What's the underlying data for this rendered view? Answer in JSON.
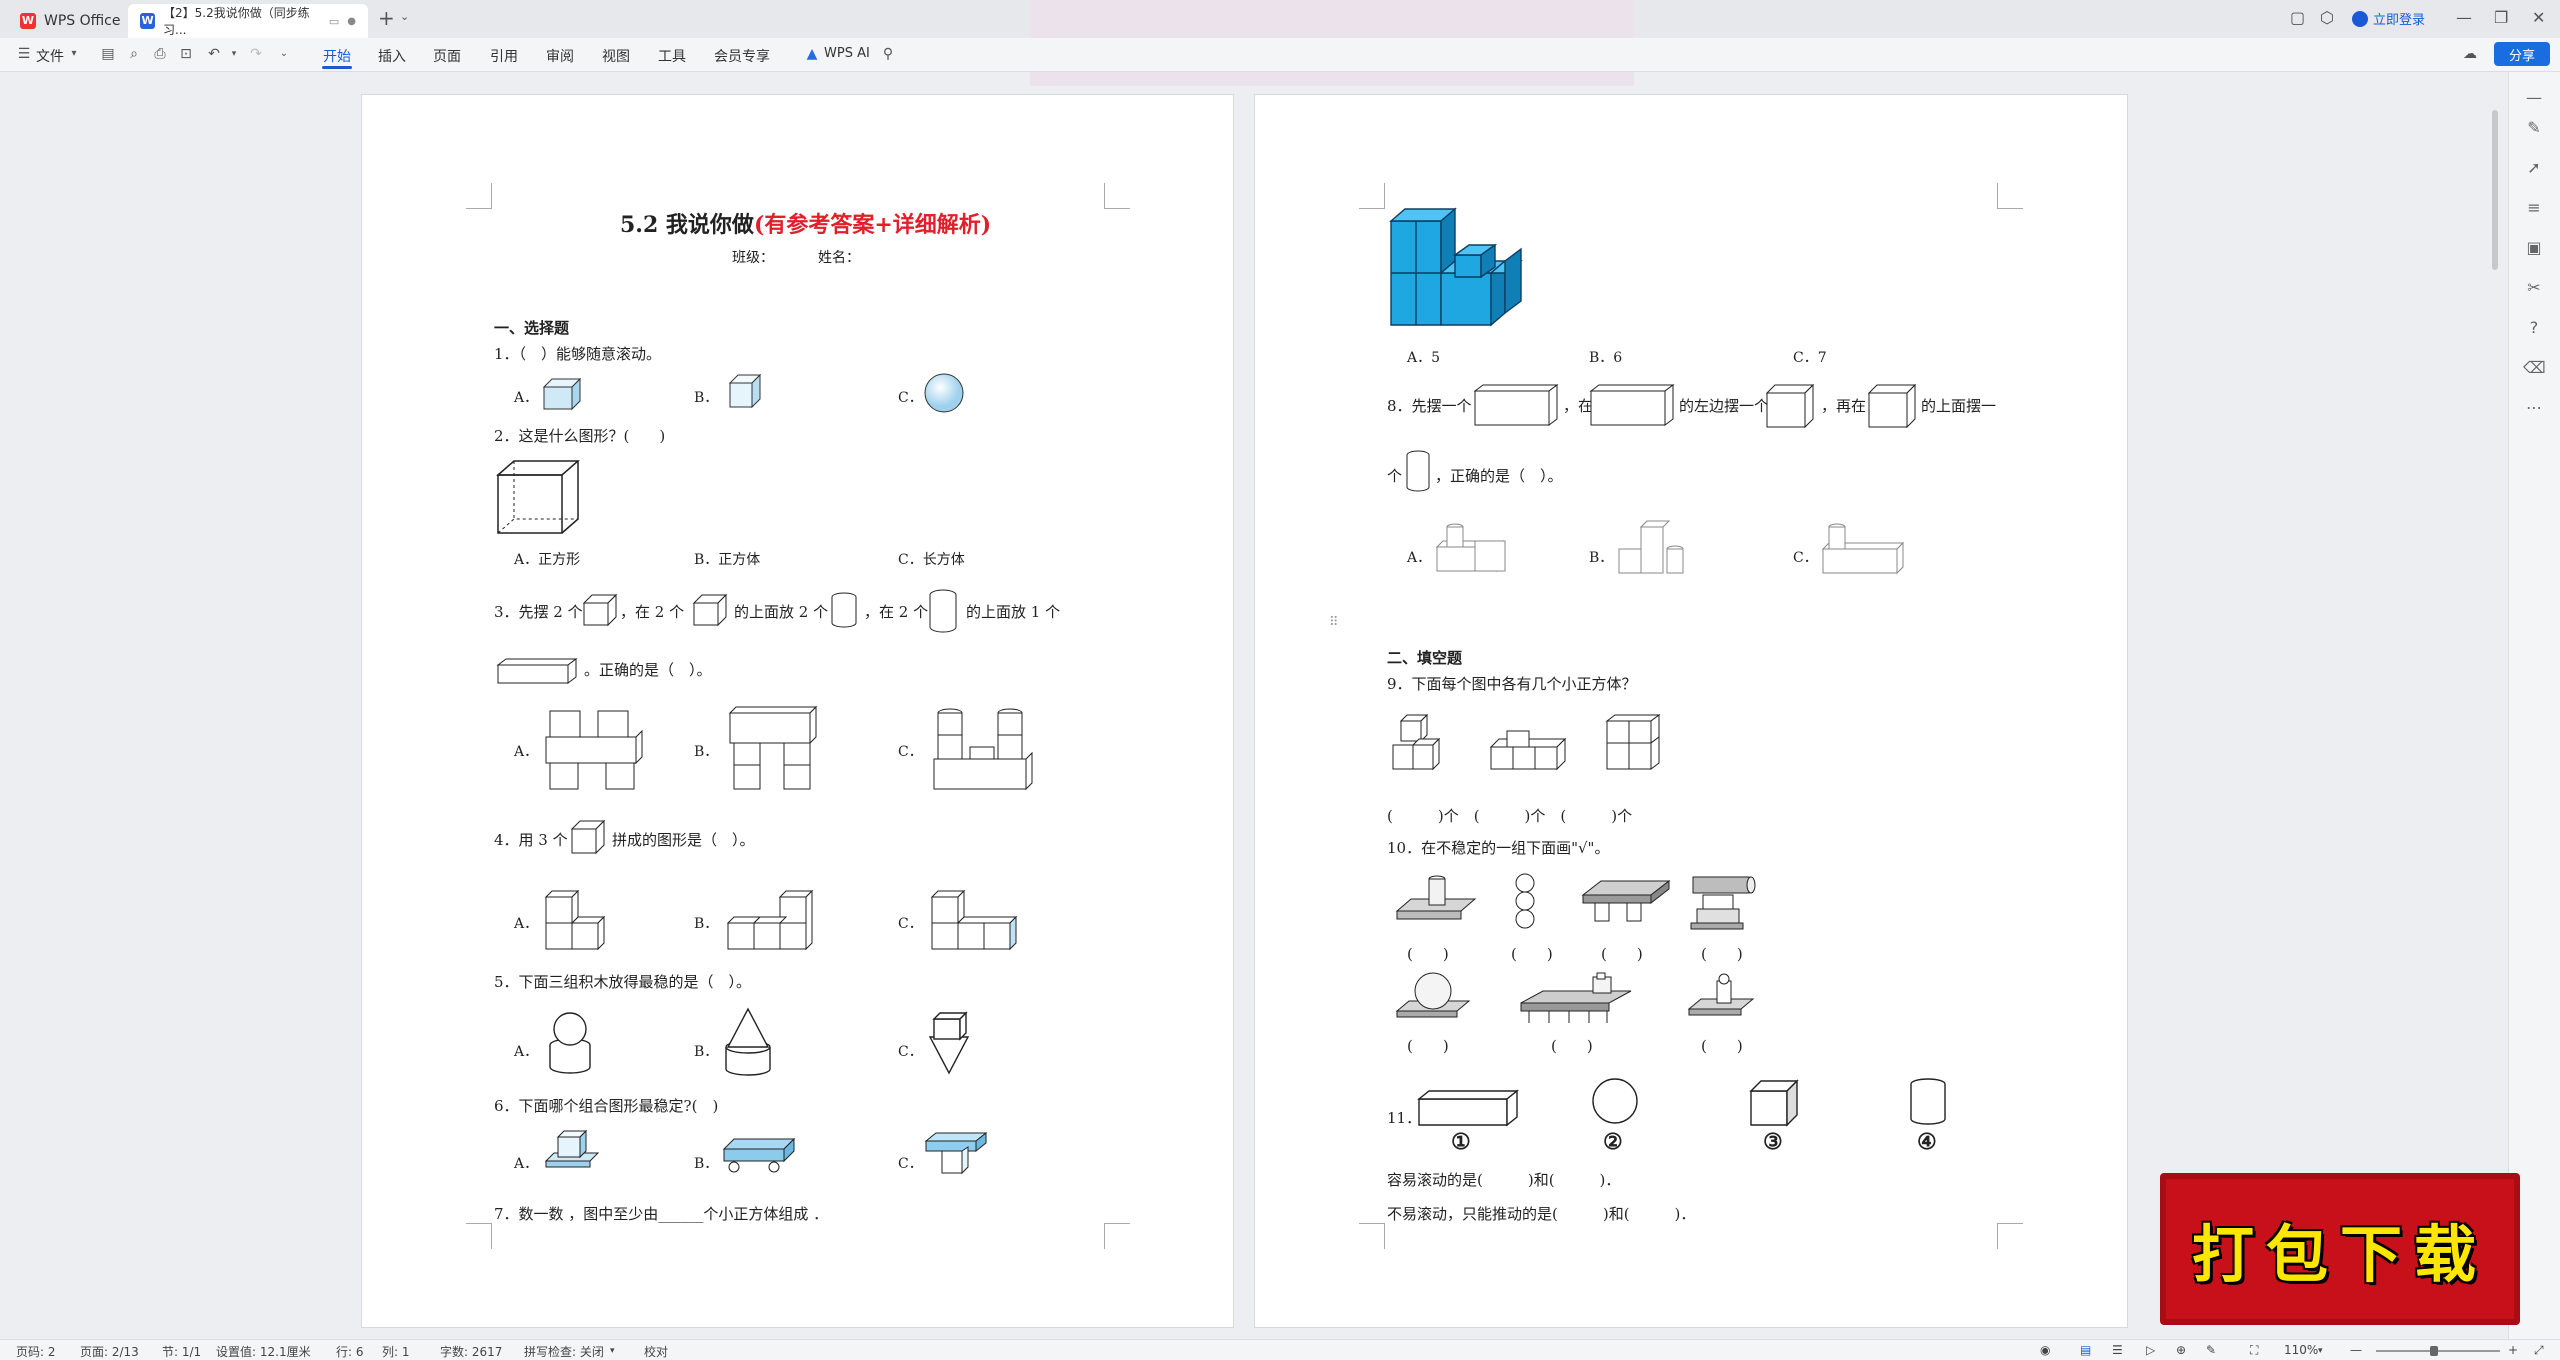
{
  "titlebar": {
    "app_tab": "WPS Office",
    "doc_tab": "【2】5.2我说你做（同步练习...",
    "new_tab": "+",
    "login": "立即登录"
  },
  "toolbar": {
    "file_menu": "文件",
    "tabs": [
      "开始",
      "插入",
      "页面",
      "引用",
      "审阅",
      "视图",
      "工具",
      "会员专享"
    ],
    "wps_ai": "WPS AI",
    "share": "分享"
  },
  "page1": {
    "title_main": "5.2 我说你做",
    "title_red": "(有参考答案+详细解析)",
    "class_label": "班级：",
    "name_label": "姓名：",
    "section1": "一、选择题",
    "q1": "1．（　）能够随意滚动。",
    "q1_opts": [
      "A．",
      "B．",
      "C．"
    ],
    "q2": "2．这是什么图形？(　　)",
    "q2_opts": [
      "A．正方形",
      "B．正方体",
      "C．长方体"
    ],
    "q3_line1_a": "3．先摆 2 个",
    "q3_line1_b": "，在 2 个",
    "q3_line1_c": "的上面放 2 个",
    "q3_line1_d": "，在 2 个",
    "q3_line1_e": "的上面放 1 个",
    "q3_line2": "。正确的是（　）。",
    "q3_opts": [
      "A．",
      "B．",
      "C．"
    ],
    "q4_a": "4．用 3 个",
    "q4_b": "拼成的图形是（　）。",
    "q4_opts": [
      "A．",
      "B．",
      "C．"
    ],
    "q5": "5．下面三组积木放得最稳的是（　）。",
    "q5_opts": [
      "A．",
      "B．",
      "C．"
    ],
    "q6": "6．下面哪个组合图形最稳定?(　)",
    "q6_opts": [
      "A．",
      "B．",
      "C．"
    ],
    "q7": "7．数一数 ，图中至少由______个小正方体组成 ．"
  },
  "page2": {
    "q7_opts": [
      "A．5",
      "B．6",
      "C．7"
    ],
    "q8_a": "8．先摆一个",
    "q8_b": "，在",
    "q8_c": "的左边摆一个",
    "q8_d": "，再在",
    "q8_e": "的上面摆一",
    "q8_line2_a": "个",
    "q8_line2_b": "，正确的是（　）。",
    "q8_opts": [
      "A．",
      "B．",
      "C．"
    ],
    "section2": "二、填空题",
    "q9": "9．下面每个图中各有几个小正方体？",
    "q9_blanks": "(　　　)个　(　　　)个　(　　　)个",
    "q10": "10．在不稳定的一组下面画\"√\"。",
    "q10_parens": "(　　)",
    "q11_label": "11．",
    "q11_nums": [
      "①",
      "②",
      "③",
      "④"
    ],
    "q11_line1": "容易滚动的是(　　　)和(　　　)．",
    "q11_line2": "不易滚动，只能推动的是(　　　)和(　　　)．"
  },
  "statusbar": {
    "page_num": "页码: 2",
    "page_of": "页面: 2/13",
    "section": "节: 1/1",
    "setting": "设置值: 12.1厘米",
    "row": "行: 6",
    "col": "列: 1",
    "words": "字数: 2617",
    "spell": "拼写检查: 关闭",
    "proof": "校对",
    "zoom": "110%"
  },
  "banner": {
    "text": "打包下载"
  },
  "colors": {
    "accent": "#1a5ad7",
    "title_red": "#e0202a",
    "banner_red": "#c8101a",
    "banner_text": "#ffe600",
    "cube_blue": "#1ea7e1"
  }
}
